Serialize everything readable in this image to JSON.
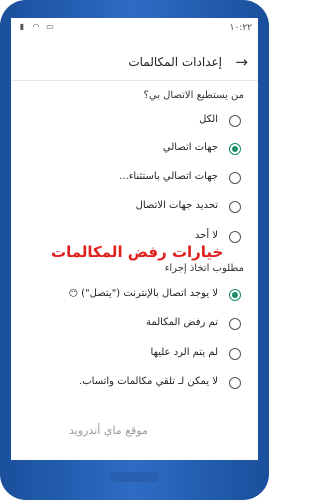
{
  "status": {
    "time": "١٠:٢٢",
    "icons": [
      "signal-icon",
      "wifi-icon",
      "battery-icon"
    ]
  },
  "header": {
    "title": "إعدادات المكالمات",
    "back_icon": "arrow-right-icon"
  },
  "who_can_call": {
    "heading": "من يستطيع الاتصال بي؟",
    "options": [
      {
        "label": "الكل",
        "selected": false
      },
      {
        "label": "جهات اتصالي",
        "selected": true
      },
      {
        "label": "جهات اتصالي باستثناء...",
        "selected": false
      },
      {
        "label": "تحديد جهات الاتصال",
        "selected": false
      },
      {
        "label": "لا أحد",
        "selected": false
      }
    ]
  },
  "overlay": {
    "red_text": "خيارات رفض المكالمات"
  },
  "action_required": {
    "heading": "مطلوب اتخاذ إجراء",
    "options": [
      {
        "label": "لا يوجد اتصال بالإنترنت (\"يتصل\")",
        "selected": true,
        "emoji": "😶"
      },
      {
        "label": "تم رفض المكالمة",
        "selected": false
      },
      {
        "label": "لم يتم الرد عليها",
        "selected": false
      },
      {
        "label": "لا يمكن لـ  تلقي مكالمات واتساب.",
        "selected": false
      }
    ]
  },
  "watermark": "موقع ماي أندرويد",
  "colors": {
    "accent": "#1b8c6a",
    "frame": "#2e6cc4",
    "red_overlay": "#e0201c"
  }
}
